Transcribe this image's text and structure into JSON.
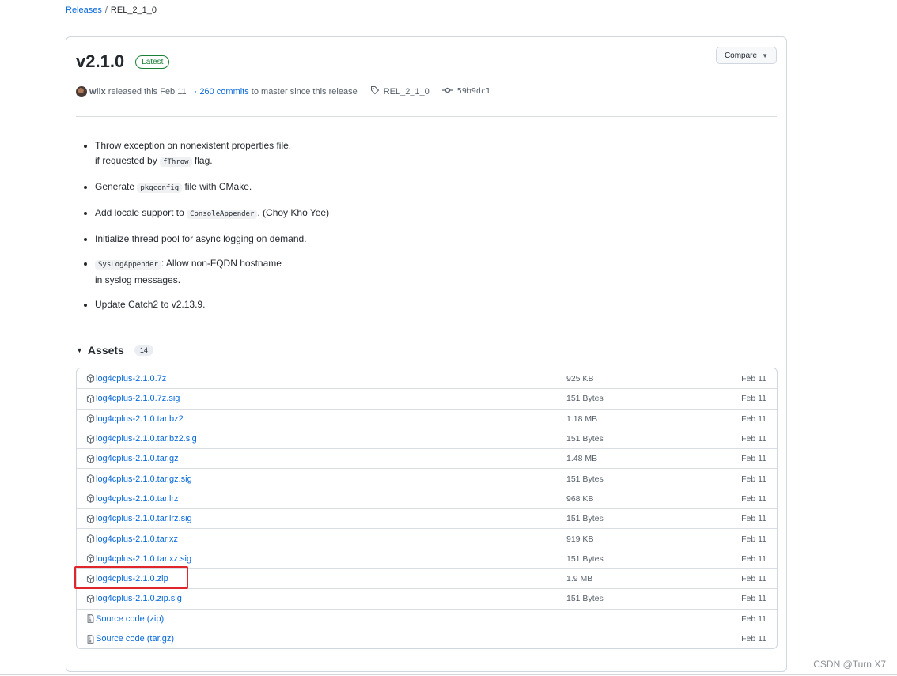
{
  "breadcrumb": {
    "releases": "Releases",
    "separator": "/",
    "current": "REL_2_1_0"
  },
  "release": {
    "version": "v2.1.0",
    "badge": "Latest",
    "compare_label": "Compare",
    "author": "wilx",
    "released_text": "released this Feb 11",
    "commits_link": "· 260 commits",
    "commits_suffix": "to master since this release",
    "tag": "REL_2_1_0",
    "commit_sha": "59b9dc1"
  },
  "notes": {
    "items": [
      {
        "before": "Throw exception on nonexistent properties file,",
        "line2": "if requested by",
        "code": "fThrow",
        "after": "flag."
      },
      {
        "before": "Generate",
        "code": "pkgconfig",
        "after": "file with CMake."
      },
      {
        "before": "Add locale support to",
        "code": "ConsoleAppender",
        "after": ". (Choy Kho Yee)"
      },
      {
        "before": "Initialize thread pool for async logging on demand."
      },
      {
        "code": "SysLogAppender",
        "after": ": Allow non-FQDN hostname",
        "line2": "in syslog messages."
      },
      {
        "before": "Update Catch2 to v2.13.9."
      }
    ]
  },
  "assets": {
    "title": "Assets",
    "count": "14",
    "rows": [
      {
        "name": "log4cplus-2.1.0.7z",
        "size": "925 KB",
        "date": "Feb 11"
      },
      {
        "name": "log4cplus-2.1.0.7z.sig",
        "size": "151 Bytes",
        "date": "Feb 11"
      },
      {
        "name": "log4cplus-2.1.0.tar.bz2",
        "size": "1.18 MB",
        "date": "Feb 11"
      },
      {
        "name": "log4cplus-2.1.0.tar.bz2.sig",
        "size": "151 Bytes",
        "date": "Feb 11"
      },
      {
        "name": "log4cplus-2.1.0.tar.gz",
        "size": "1.48 MB",
        "date": "Feb 11"
      },
      {
        "name": "log4cplus-2.1.0.tar.gz.sig",
        "size": "151 Bytes",
        "date": "Feb 11"
      },
      {
        "name": "log4cplus-2.1.0.tar.lrz",
        "size": "968 KB",
        "date": "Feb 11"
      },
      {
        "name": "log4cplus-2.1.0.tar.lrz.sig",
        "size": "151 Bytes",
        "date": "Feb 11"
      },
      {
        "name": "log4cplus-2.1.0.tar.xz",
        "size": "919 KB",
        "date": "Feb 11"
      },
      {
        "name": "log4cplus-2.1.0.tar.xz.sig",
        "size": "151 Bytes",
        "date": "Feb 11"
      },
      {
        "name": "log4cplus-2.1.0.zip",
        "size": "1.9 MB",
        "date": "Feb 11"
      },
      {
        "name": "log4cplus-2.1.0.zip.sig",
        "size": "151 Bytes",
        "date": "Feb 11"
      }
    ],
    "source_rows": [
      {
        "name": "Source code",
        "sub": "(zip)",
        "date": "Feb 11"
      },
      {
        "name": "Source code",
        "sub": "(tar.gz)",
        "date": "Feb 11"
      }
    ]
  },
  "watermark": "CSDN @Turn X7",
  "colors": {
    "link": "#0969da",
    "latest": "#1a7f37",
    "highlight": "#e0262a"
  }
}
